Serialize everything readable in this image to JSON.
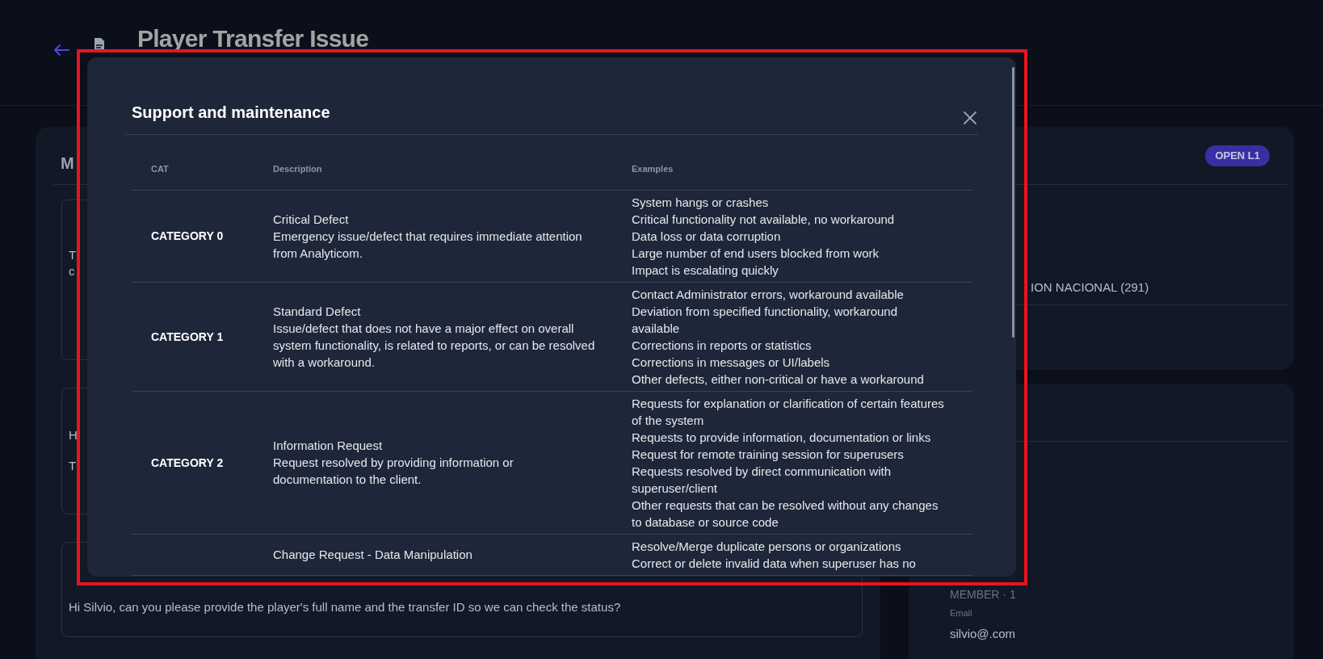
{
  "page": {
    "title": "Player Transfer Issue"
  },
  "messages_panel": {
    "heading": "M",
    "messages": [
      {
        "lines": [
          "T",
          "c"
        ]
      },
      {
        "lines": [
          "H",
          "T"
        ]
      },
      {
        "lines": [
          "Hi Silvio, can you please provide the player's full name and the transfer ID so we can check the status?"
        ]
      }
    ]
  },
  "details_panel": {
    "status_badge": "OPEN L1",
    "organization": "ION NACIONAL (291)"
  },
  "contact_panel": {
    "role": "MEMBER · 1",
    "email_label": "Email",
    "email": "silvio@.com"
  },
  "modal": {
    "title": "Support and maintenance",
    "columns": [
      "CAT",
      "Description",
      "Examples"
    ],
    "rows": [
      {
        "category": "CATEGORY 0",
        "description_title": "Critical Defect",
        "description": "Emergency issue/defect that requires immediate attention from Analyticom.",
        "examples": [
          "System hangs or crashes",
          "Critical functionality not available, no workaround",
          "Data loss or data corruption",
          "Large number of end users blocked from work",
          "Impact is escalating quickly"
        ]
      },
      {
        "category": "CATEGORY 1",
        "description_title": "Standard Defect",
        "description": "Issue/defect that does not have a major effect on overall system functionality, is related to reports, or can be resolved with a workaround.",
        "examples": [
          "Contact Administrator errors, workaround available",
          "Deviation from specified functionality, workaround available",
          "Corrections in reports or statistics",
          "Corrections in messages or UI/labels",
          "Other defects, either non-critical or have a workaround"
        ]
      },
      {
        "category": "CATEGORY 2",
        "description_title": "Information Request",
        "description": "Request resolved by providing information or documentation to the client.",
        "examples": [
          "Requests for explanation or clarification of certain features of the system",
          "Requests to provide information, documentation or links",
          "Request for remote training session for superusers",
          "Requests resolved by direct communication with superuser/client",
          "Other requests that can be resolved without any changes to database or source code"
        ]
      },
      {
        "description_title": "Change Request - Data Manipulation",
        "examples": [
          "Resolve/Merge duplicate persons or organizations",
          "Correct or delete invalid data when superuser has no"
        ]
      }
    ]
  }
}
